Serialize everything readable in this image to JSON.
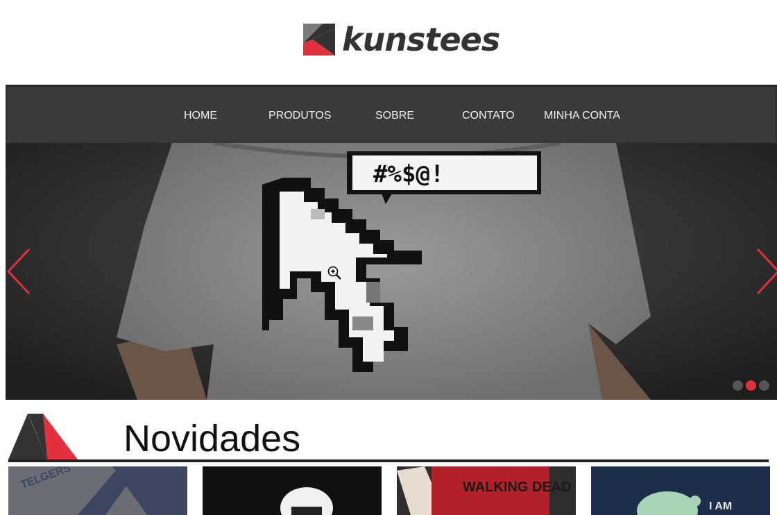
{
  "brand": {
    "name": "kunstees",
    "logo_colors": {
      "dark": "#333333",
      "red": "#e2303c"
    }
  },
  "nav": {
    "items": [
      {
        "label": "HOME"
      },
      {
        "label": "PRODUTOS"
      },
      {
        "label": "SOBRE"
      },
      {
        "label": "CONTATO"
      },
      {
        "label": "MINHA CONTA"
      }
    ]
  },
  "slider": {
    "slide_count": 3,
    "active_slide": 2,
    "speech_bubble_text": "#%$@!",
    "accent": "#e2303c"
  },
  "section": {
    "title": "Novidades"
  },
  "products": [
    {
      "name": "product-1",
      "text": "TELGERS"
    },
    {
      "name": "product-2",
      "text": ""
    },
    {
      "name": "product-3",
      "text": "WALKING DEAD"
    },
    {
      "name": "product-4",
      "text": "I AM"
    }
  ]
}
